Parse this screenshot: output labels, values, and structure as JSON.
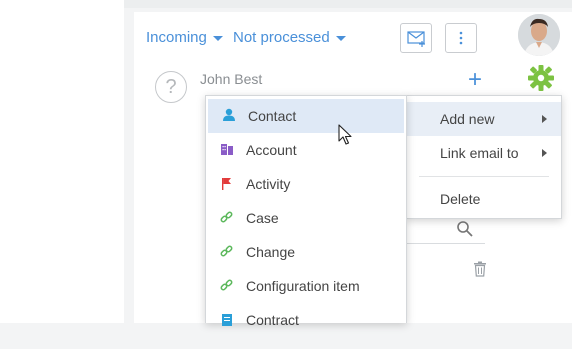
{
  "filters": {
    "incoming": "Incoming",
    "not_processed": "Not processed"
  },
  "email": {
    "sender": "John Best",
    "unknown_mark": "?"
  },
  "submenu": {
    "items": [
      {
        "label": "Contact",
        "icon": "person-icon",
        "color": "#2a9fd8"
      },
      {
        "label": "Account",
        "icon": "building-icon",
        "color": "#8a5cc7"
      },
      {
        "label": "Activity",
        "icon": "flag-icon",
        "color": "#e23b3b"
      },
      {
        "label": "Case",
        "icon": "chain-icon",
        "color": "#5cb85c"
      },
      {
        "label": "Change",
        "icon": "chain-icon",
        "color": "#5cb85c"
      },
      {
        "label": "Configuration item",
        "icon": "chain-icon",
        "color": "#5cb85c"
      },
      {
        "label": "Contract",
        "icon": "document-icon",
        "color": "#2a9fd8"
      }
    ]
  },
  "context_menu": {
    "add_new": "Add new",
    "link_email_to": "Link email to",
    "delete": "Delete"
  },
  "colors": {
    "accent": "#4a90d9",
    "gear": "#7cc242"
  }
}
